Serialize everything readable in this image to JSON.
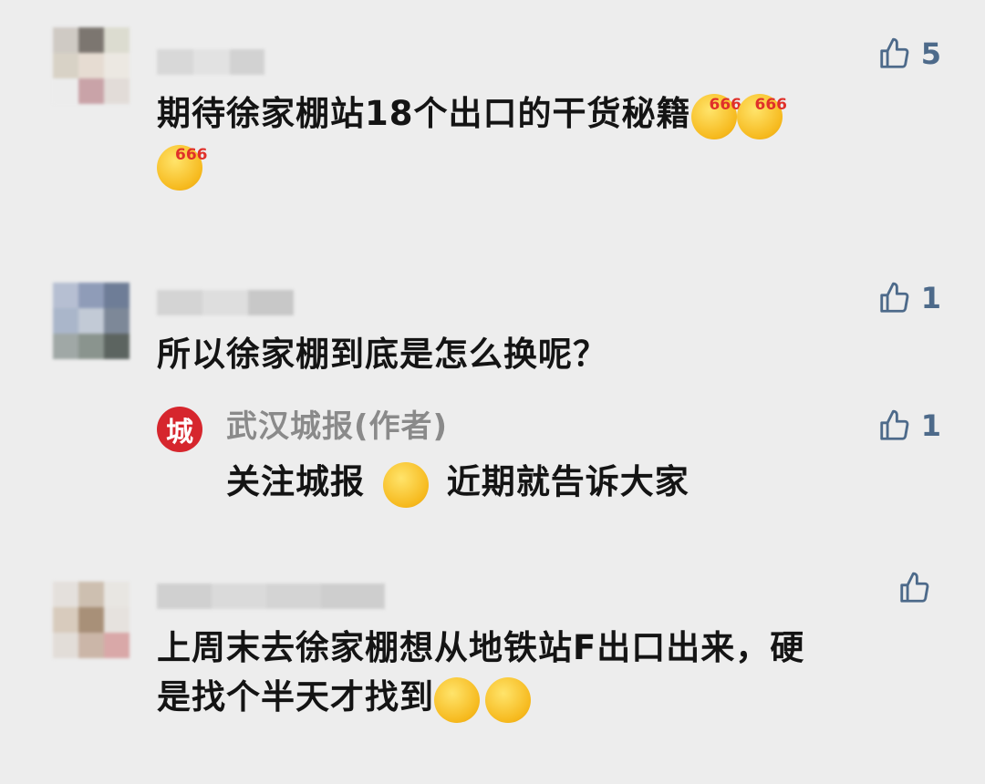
{
  "comments": [
    {
      "text": "期待徐家棚站18个出口的干货秘籍",
      "likes": "5",
      "emoji": "smirk-666-emoji",
      "emoji_badge": "666"
    },
    {
      "text": "所以徐家棚到底是怎么换呢？",
      "likes": "1",
      "reply": {
        "author": "武汉城报(作者)",
        "avatar_char": "城",
        "text_before": "关注城报",
        "emoji": "smile-emoji",
        "text_after": "近期就告诉大家",
        "likes": "1"
      }
    },
    {
      "text_line1": "上周末去徐家棚想从地铁站F出口出来，硬",
      "text_line2": "是找个半天才找到",
      "likes": "",
      "emoji": "facepalm-emoji"
    }
  ],
  "colors": {
    "background": "#ededed",
    "like_icon": "#4d6a8a",
    "reply_avatar": "#d6262d",
    "reply_name": "#8a8a8a"
  }
}
